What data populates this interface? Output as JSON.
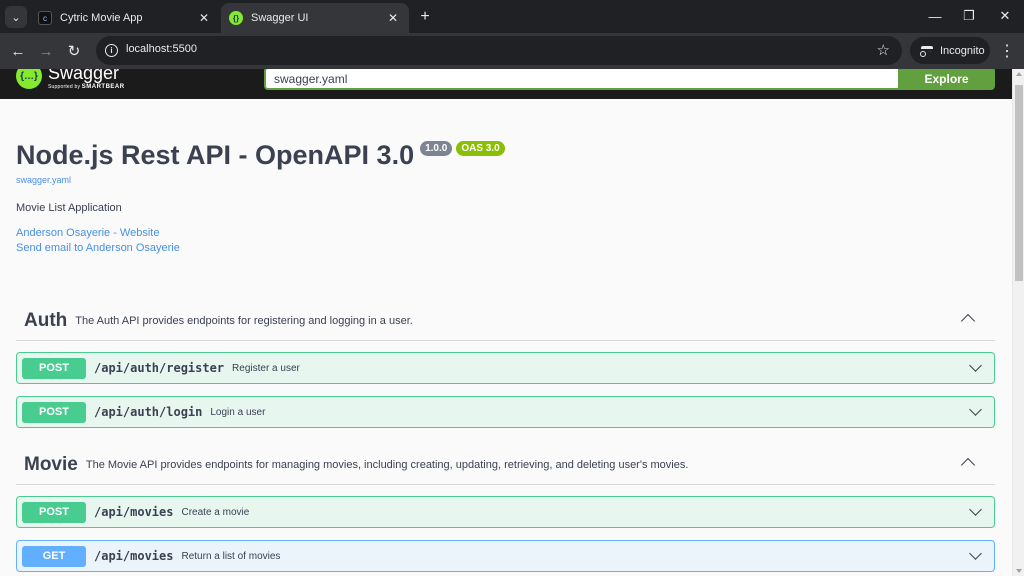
{
  "browser": {
    "tabs": [
      {
        "title": "Cytric Movie App",
        "active": false
      },
      {
        "title": "Swagger UI",
        "active": true
      }
    ],
    "url": "localhost:5500",
    "incognito_label": "Incognito"
  },
  "swagger": {
    "logo_name": "Swagger",
    "logo_supported": "Supported by",
    "logo_company": "SMARTBEAR",
    "search_value": "swagger.yaml",
    "explore_label": "Explore"
  },
  "info": {
    "title": "Node.js Rest API - OpenAPI 3.0",
    "version_badge": "1.0.0",
    "oas_badge": "OAS 3.0",
    "spec_link": "swagger.yaml",
    "description": "Movie List Application",
    "links": [
      "Anderson Osayerie - Website",
      "Send email to Anderson Osayerie"
    ]
  },
  "tags": [
    {
      "name": "Auth",
      "description": "The Auth API provides endpoints for registering and logging in a user.",
      "operations": [
        {
          "method": "POST",
          "path": "/api/auth/register",
          "summary": "Register a user"
        },
        {
          "method": "POST",
          "path": "/api/auth/login",
          "summary": "Login a user"
        }
      ]
    },
    {
      "name": "Movie",
      "description": "The Movie API provides endpoints for managing movies, including creating, updating, retrieving, and deleting user's movies.",
      "operations": [
        {
          "method": "POST",
          "path": "/api/movies",
          "summary": "Create a movie"
        },
        {
          "method": "GET",
          "path": "/api/movies",
          "summary": "Return a list of movies"
        }
      ]
    }
  ],
  "colors": {
    "post": "#49cc90",
    "get": "#61affe",
    "swagger_green": "#62a03f",
    "link": "#4990e2"
  }
}
